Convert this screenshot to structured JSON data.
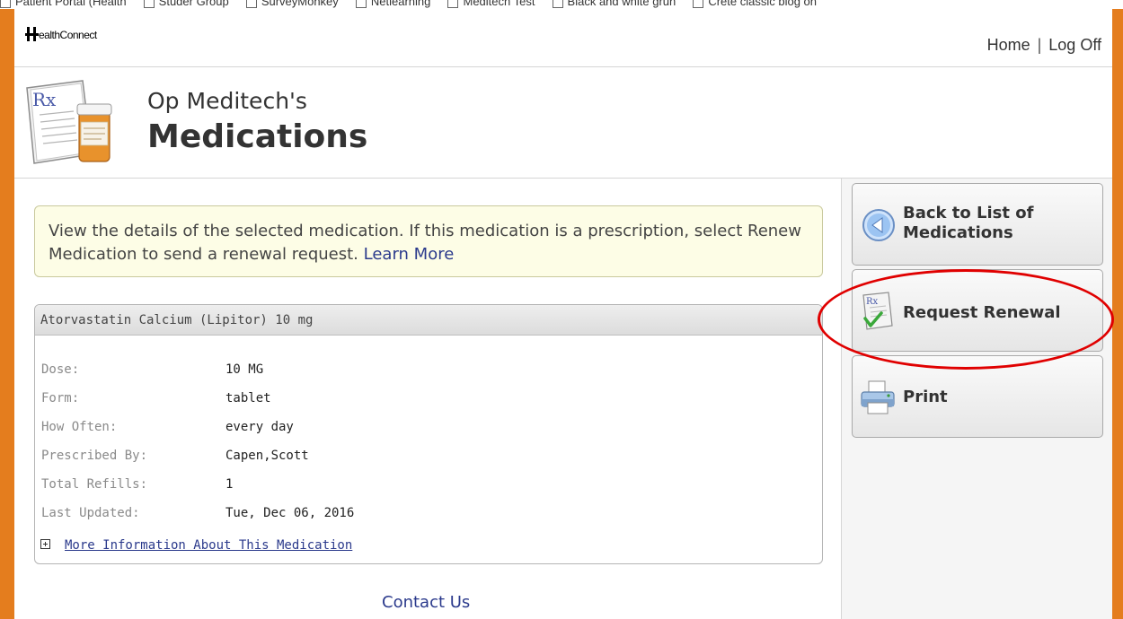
{
  "bookmarks": [
    {
      "label": "Patient Portal (Health"
    },
    {
      "label": "Studer Group"
    },
    {
      "label": "SurveyMonkey"
    },
    {
      "label": "Netlearning"
    },
    {
      "label": "Meditech Test"
    },
    {
      "label": "Black and white grun"
    },
    {
      "label": "Crete classic blog on"
    }
  ],
  "header": {
    "logo_text": "ealthConnect",
    "nav_home": "Home",
    "nav_separator": "|",
    "nav_logoff": "Log Off"
  },
  "page": {
    "subtitle": "Op Meditech's",
    "title": "Medications",
    "rx_label": "Rx"
  },
  "info": {
    "text": "View the details of the selected medication. If this medication is a prescription, select Renew Medication to send a renewal request.",
    "link": "Learn More"
  },
  "medication": {
    "name": "Atorvastatin Calcium (Lipitor) 10 mg",
    "fields": [
      {
        "label": "Dose:",
        "value": "10 MG"
      },
      {
        "label": "Form:",
        "value": "tablet"
      },
      {
        "label": "How Often:",
        "value": "every day"
      },
      {
        "label": "Prescribed By:",
        "value": "Capen,Scott"
      },
      {
        "label": "Total Refills:",
        "value": "1"
      },
      {
        "label": "Last Updated:",
        "value": "Tue, Dec 06, 2016"
      }
    ],
    "more_info_link": "More Information About This Medication"
  },
  "actions": {
    "back_label": "Back to List of Medications",
    "renew_label": "Request Renewal",
    "print_label": "Print"
  },
  "footer": {
    "contact": "Contact Us"
  },
  "colors": {
    "side_bar": "#e47d1e",
    "link": "#2b3a8c",
    "highlight": "#e00000",
    "info_bg": "#fdfde6"
  }
}
